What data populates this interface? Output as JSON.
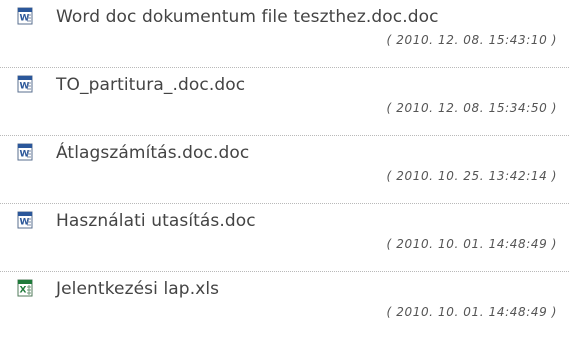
{
  "files": [
    {
      "name": "Word doc dokumentum file teszthez.doc.doc",
      "date": "( 2010. 12. 08. 15:43:10 )",
      "icon": "word-doc-icon"
    },
    {
      "name": "TO_partitura_.doc.doc",
      "date": "( 2010. 12. 08. 15:34:50 )",
      "icon": "word-doc-icon"
    },
    {
      "name": "Átlagszámítás.doc.doc",
      "date": "( 2010. 10. 25. 13:42:14 )",
      "icon": "word-doc-icon"
    },
    {
      "name": "Használati utasítás.doc",
      "date": "( 2010. 10. 01. 14:48:49 )",
      "icon": "word-doc-icon"
    },
    {
      "name": "Jelentkezési lap.xls",
      "date": "( 2010. 10. 01. 14:48:49 )",
      "icon": "excel-xls-icon"
    }
  ],
  "colors": {
    "text": "#444444",
    "separator": "#b9b9b9",
    "word_blue": "#2b579a",
    "excel_green": "#1f7a3a"
  }
}
